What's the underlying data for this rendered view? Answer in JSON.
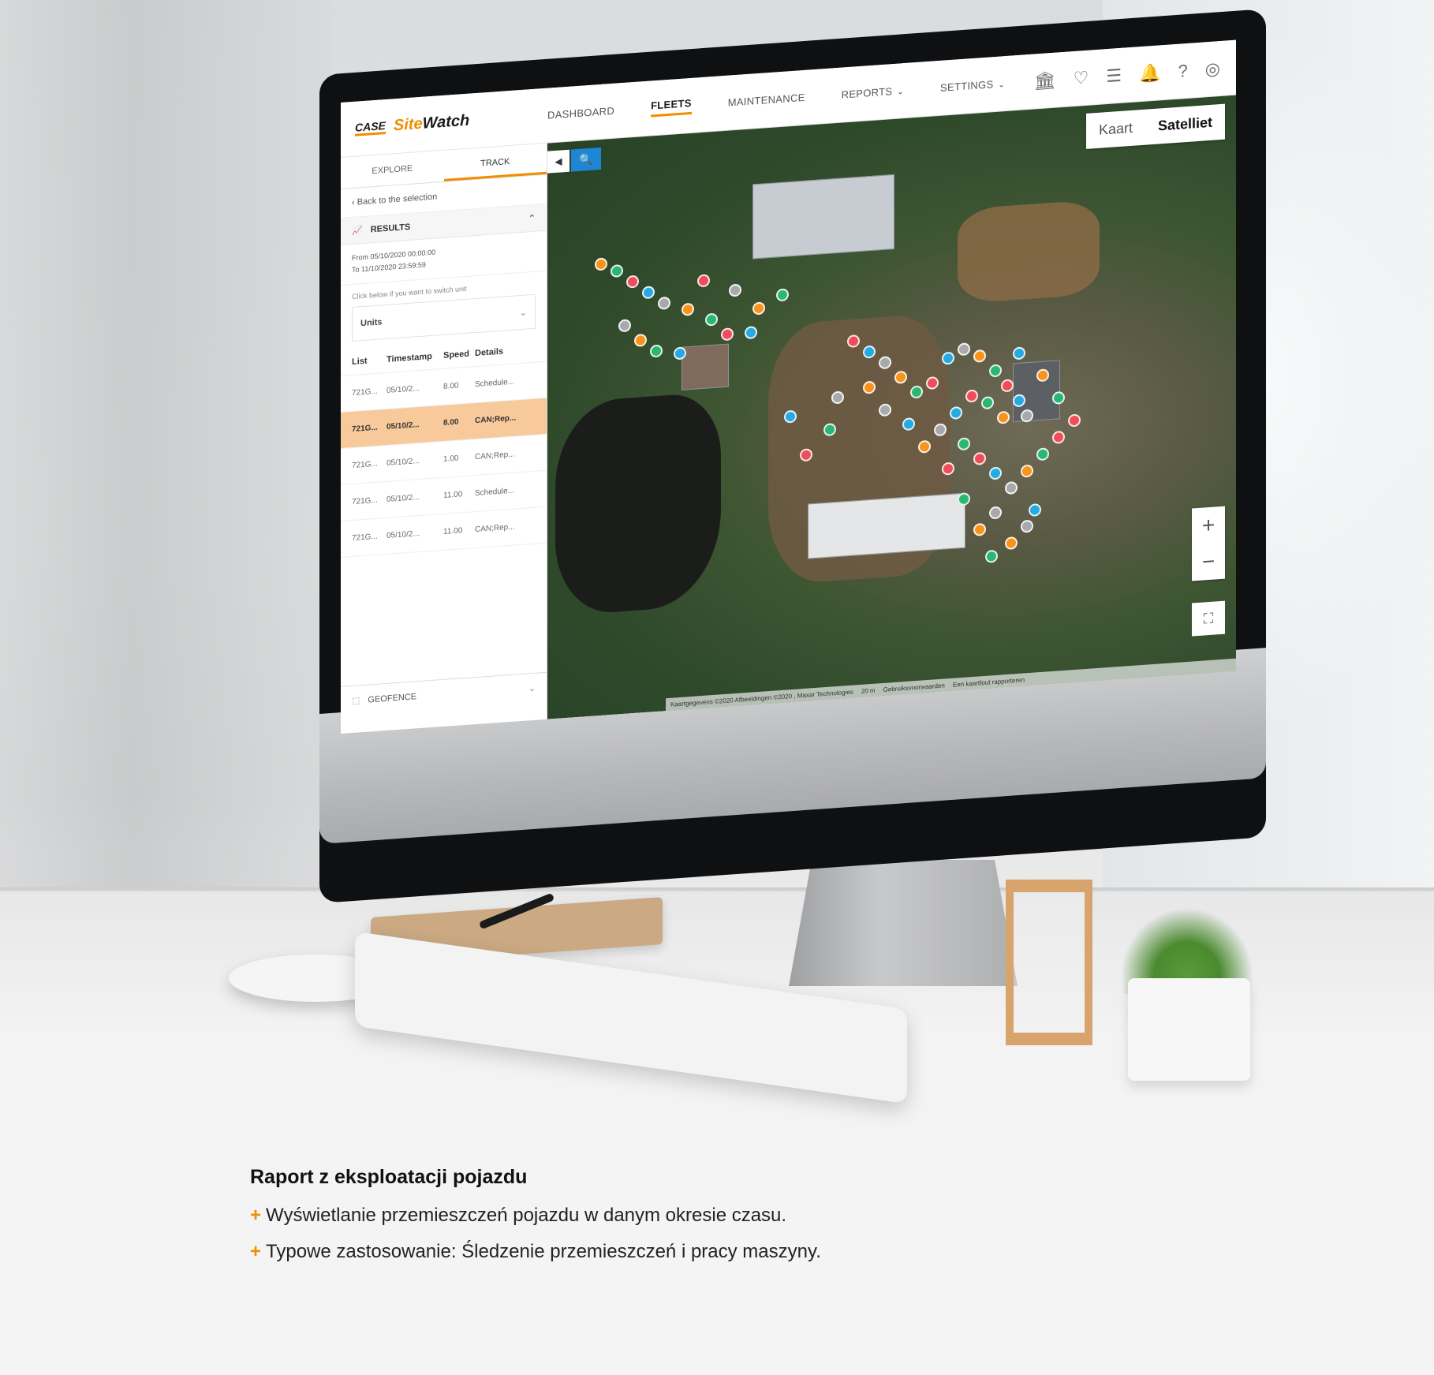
{
  "app": {
    "logo_brand": "CASE",
    "logo_site": "Site",
    "logo_watch": "Watch"
  },
  "nav": {
    "dashboard": "DASHBOARD",
    "fleets": "FLEETS",
    "maintenance": "MAINTENANCE",
    "reports": "REPORTS",
    "settings": "SETTINGS"
  },
  "header_icons": [
    "bank-icon",
    "heart-icon",
    "sliders-icon",
    "bell-icon",
    "help-icon",
    "user-icon"
  ],
  "panel": {
    "tab_explore": "EXPLORE",
    "tab_track": "TRACK",
    "back_link": "Back to the selection",
    "results_title": "RESULTS",
    "from_date": "From 05/10/2020 00:00:00",
    "to_date": "To 11/10/2020 23:59:59",
    "hint": "Click below if you want to switch unit",
    "units_label": "Units",
    "columns": [
      "List",
      "Timestamp",
      "Speed",
      "Details"
    ],
    "rows": [
      {
        "list": "721G...",
        "timestamp": "05/10/2...",
        "speed": "8.00",
        "details": "Schedule..."
      },
      {
        "list": "721G...",
        "timestamp": "05/10/2...",
        "speed": "8.00",
        "details": "CAN;Rep..."
      },
      {
        "list": "721G...",
        "timestamp": "05/10/2...",
        "speed": "1.00",
        "details": "CAN;Rep..."
      },
      {
        "list": "721G...",
        "timestamp": "05/10/2...",
        "speed": "11.00",
        "details": "Schedule..."
      },
      {
        "list": "721G...",
        "timestamp": "05/10/2...",
        "speed": "11.00",
        "details": "CAN;Rep..."
      }
    ],
    "geofence_label": "GEOFENCE"
  },
  "map": {
    "type_map": "Kaart",
    "type_satellite": "Satelliet",
    "zoom_in": "+",
    "zoom_out": "−",
    "attribution": "Kaartgegevens ©2020 Afbeeldingen ©2020 , Maxar Technologies",
    "scale": "20 m",
    "terms": "Gebruiksvoorwaarden",
    "report_error": "Een kaartfout rapporteren",
    "dot_colors": [
      "#f7941d",
      "#2bb673",
      "#ee4d5a",
      "#27a9e1",
      "#a7a9ac"
    ]
  },
  "caption": {
    "title": "Raport z eksploatacji pojazdu",
    "plus_sign": "+",
    "line1": "Wyświetlanie przemieszczeń pojazdu w danym okresie czasu.",
    "line2": "Typowe zastosowanie: Śledzenie przemieszczeń i pracy maszyny."
  }
}
